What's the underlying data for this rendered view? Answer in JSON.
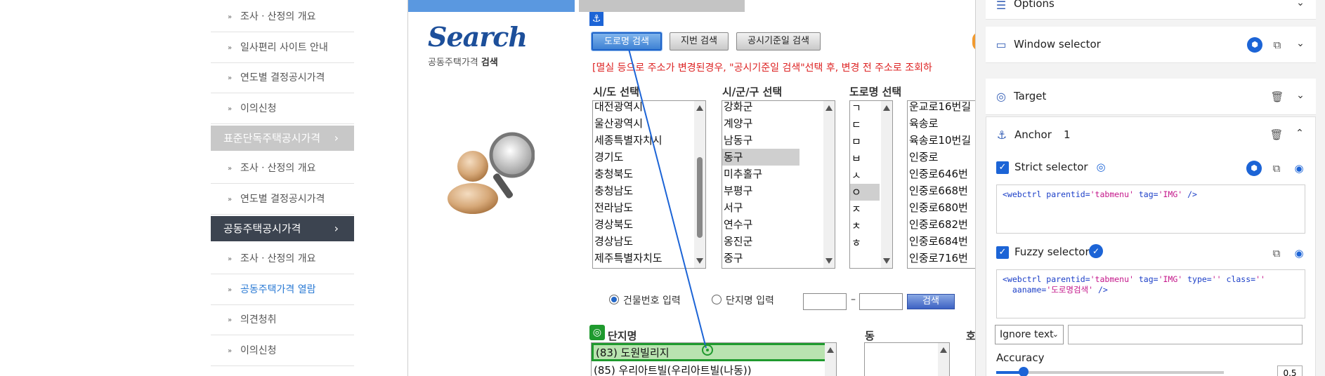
{
  "sidebar": {
    "items": [
      {
        "label": "조사ㆍ산정의 개요"
      },
      {
        "label": "일사편리 사이트 안내"
      },
      {
        "label": "연도별 결정공시가격"
      },
      {
        "label": "이의신청"
      }
    ],
    "section_standard": {
      "label": "표준단독주택공시가격"
    },
    "standard_items": [
      {
        "label": "조사ㆍ산정의 개요"
      },
      {
        "label": "연도별 결정공시가격"
      }
    ],
    "section_apartment": {
      "label": "공동주택공시가격"
    },
    "apartment_items": [
      {
        "label": "조사ㆍ산정의 개요"
      },
      {
        "label": "공동주택가격 열람",
        "active": true
      },
      {
        "label": "의견청취"
      },
      {
        "label": "이의신청"
      }
    ]
  },
  "main": {
    "logo_text": "Search",
    "logo_sub_prefix": "공동주택가격 ",
    "logo_sub_bold": "검색",
    "tabs": [
      "도로명 검색",
      "지번 검색",
      "공시기준일 검색"
    ],
    "notice": "[멸실 등으로 주소가 변경된경우, \"공시기준일 검색\"선택 후, 변경 전 주소로 조회하",
    "labels": {
      "sido": "시/도 선택",
      "sigungu": "시/군/구 선택",
      "road": "도로명 선택",
      "complex": "단지명",
      "dong": "동",
      "ho": "호"
    },
    "sido_options": [
      "대전광역시",
      "울산광역시",
      "세종특별자치시",
      "경기도",
      "충청북도",
      "충청남도",
      "전라남도",
      "경상북도",
      "경상남도",
      "제주특별자치도"
    ],
    "sigungu_options": [
      "강화군",
      "계양구",
      "남동구",
      "동구",
      "미추홀구",
      "부평구",
      "서구",
      "연수구",
      "옹진군",
      "중구"
    ],
    "sigungu_selected": "동구",
    "initial_options": [
      "ㄱ",
      "ㄷ",
      "ㅁ",
      "ㅂ",
      "ㅅ",
      "ㅇ",
      "ㅈ",
      "ㅊ",
      "ㅎ"
    ],
    "initial_selected": "ㅇ",
    "road_options": [
      "운교로16번길",
      "육송로",
      "육송로10번길",
      "인중로",
      "인중로646번",
      "인중로668번",
      "인중로680번",
      "인중로682번",
      "인중로684번",
      "인중로716번"
    ],
    "radio_building": "건물번호 입력",
    "radio_complex": "단지명 입력",
    "dash": "–",
    "search_button": "검색",
    "results": [
      "(83) 도원빌리지",
      "(85) 우리아트빌(우리아트빌(나동))"
    ]
  },
  "panel": {
    "options_title": "Options",
    "window_selector_title": "Window selector",
    "target_title": "Target",
    "anchor_title": "Anchor",
    "anchor_count": "1",
    "strict_label": "Strict selector",
    "strict_code_1": "<webctrl parentid=",
    "strict_code_2": "'tabmenu'",
    "strict_code_3": " tag=",
    "strict_code_4": "'IMG'",
    "strict_code_5": " />",
    "fuzzy_label": "Fuzzy selector",
    "fuzzy_line1_a": "<webctrl parentid=",
    "fuzzy_line1_b": "'tabmenu'",
    "fuzzy_line1_c": " tag=",
    "fuzzy_line1_d": "'IMG'",
    "fuzzy_line1_e": " type=",
    "fuzzy_line1_f": "''",
    "fuzzy_line1_g": " class=",
    "fuzzy_line1_h": "''",
    "fuzzy_line2_a": "  aaname=",
    "fuzzy_line2_b": "'도로명검색'",
    "fuzzy_line2_c": " />",
    "ignore_option": "Ignore text",
    "accuracy_label": "Accuracy",
    "accuracy_value": "0.5",
    "accuracy_fraction": 0.12
  },
  "colors": {
    "accent_blue": "#1c64d6",
    "target_green": "#1f9a2e",
    "notice_red": "#d22222"
  }
}
